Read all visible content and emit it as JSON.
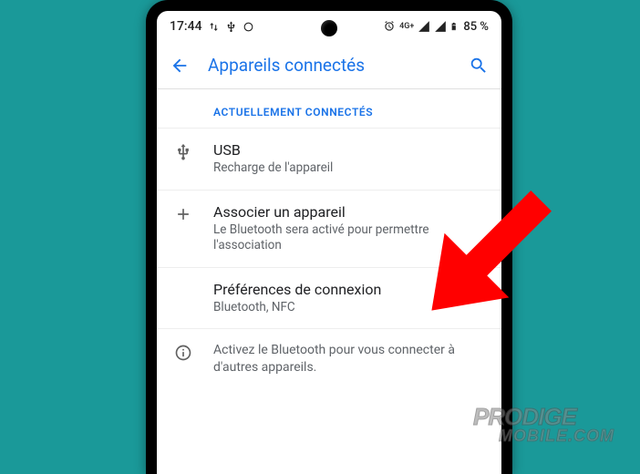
{
  "status": {
    "time": "17:44",
    "network": "4G+",
    "battery": "85 %"
  },
  "header": {
    "title": "Appareils connectés"
  },
  "section": {
    "label": "ACTUELLEMENT CONNECTÉS"
  },
  "items": {
    "usb": {
      "title": "USB",
      "subtitle": "Recharge de l'appareil"
    },
    "pair": {
      "title": "Associer un appareil",
      "subtitle": "Le Bluetooth sera activé pour permettre l'association"
    },
    "prefs": {
      "title": "Préférences de connexion",
      "subtitle": "Bluetooth, NFC"
    }
  },
  "info": {
    "text": "Activez le Bluetooth pour vous connecter à d'autres appareils."
  },
  "watermark": {
    "line1": "PRODIGE",
    "line2": "MOBILE.COM"
  }
}
